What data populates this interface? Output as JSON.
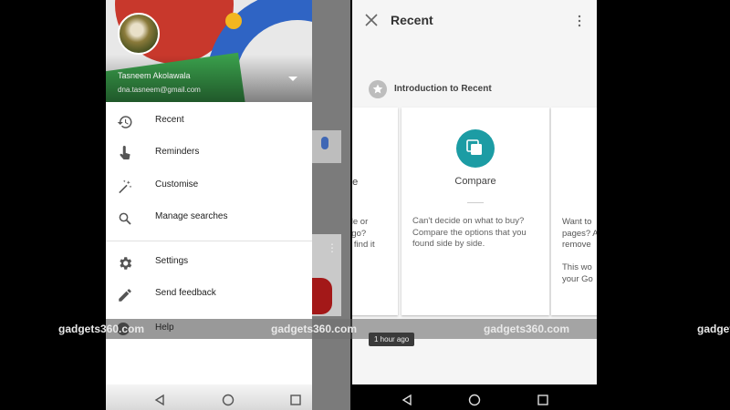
{
  "drawer": {
    "account_name": "Tasneem Akolawala",
    "account_email": "dna.tasneem@gmail.com",
    "items": [
      {
        "label": "Recent",
        "icon": "history-icon"
      },
      {
        "label": "Reminders",
        "icon": "hand-pointer-icon"
      },
      {
        "label": "Customise",
        "icon": "magic-wand-icon"
      },
      {
        "label": "Manage searches",
        "icon": "search-icon"
      },
      {
        "label": "Settings",
        "icon": "gear-icon"
      },
      {
        "label": "Send feedback",
        "icon": "pencil-icon"
      },
      {
        "label": "Help",
        "icon": "help-icon"
      }
    ]
  },
  "recent": {
    "title": "Recent",
    "intro_label": "Introduction to Recent",
    "left_card": {
      "title_fragment": "ge",
      "text_fragment": "cle or\nago?\nd find it"
    },
    "main_card": {
      "title": "Compare",
      "description": "Can't decide on what to buy? Compare the options that you found side by side."
    },
    "right_card": {
      "text_fragment": "Want to\npages? A\nremove",
      "text_fragment_2": "This wo\nyour Go"
    },
    "timestamp": "1 hour ago"
  },
  "watermarks": [
    "gadgets360.com",
    "gadgets360.com",
    "gadgets360.com",
    "gadgets"
  ],
  "colors": {
    "compare_accent": "#1c9ca4",
    "google_red": "#c8382c",
    "google_blue": "#2f64c4",
    "google_green": "#3aa04c",
    "google_yellow": "#f3b620"
  }
}
